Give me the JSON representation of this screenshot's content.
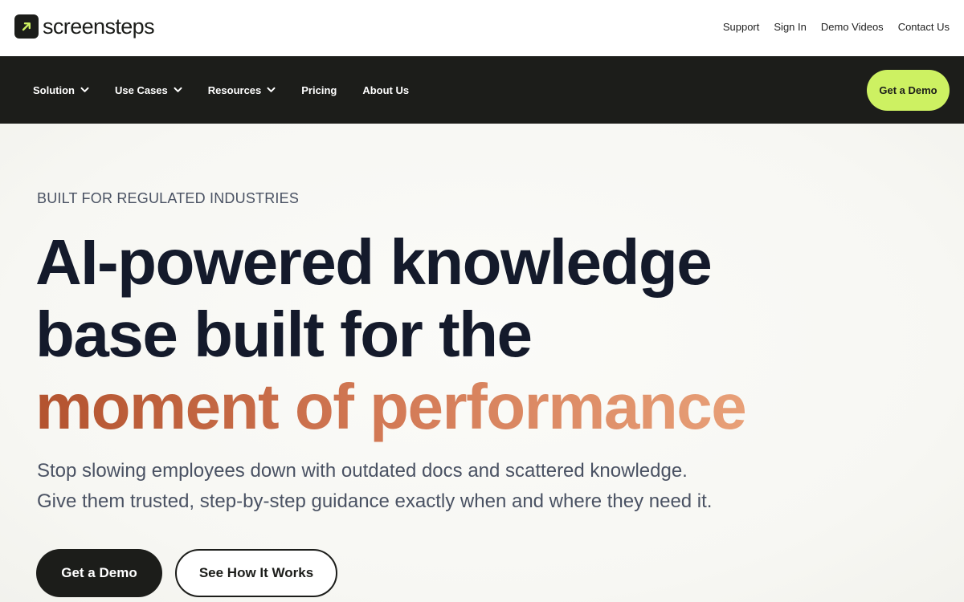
{
  "brand": {
    "name": "screensteps",
    "logo_bg": "#1c1d1a",
    "logo_accent": "#cdf162"
  },
  "utility_nav": {
    "items": [
      "Support",
      "Sign In",
      "Demo Videos",
      "Contact Us"
    ]
  },
  "main_nav": {
    "items": [
      {
        "label": "Solution",
        "dropdown": true
      },
      {
        "label": "Use Cases",
        "dropdown": true
      },
      {
        "label": "Resources",
        "dropdown": true
      },
      {
        "label": "Pricing",
        "dropdown": false
      },
      {
        "label": "About Us",
        "dropdown": false
      }
    ],
    "cta_label": "Get a Demo",
    "bg": "#1c1d1a",
    "cta_color": "#cdf162"
  },
  "hero": {
    "eyebrow": "BUILT FOR REGULATED INDUSTRIES",
    "headline_line1": "AI-powered knowledge",
    "headline_line2": "base built for the",
    "headline_accent": "moment of performance",
    "subtext_line1": "Stop slowing employees down with outdated docs and scattered knowledge.",
    "subtext_line2": "Give them trusted, step-by-step guidance exactly when and where they need it.",
    "primary_cta": "Get a Demo",
    "secondary_cta": "See How It Works",
    "accent_gradient": [
      "#b3532f",
      "#d37a56",
      "#e8a078"
    ]
  }
}
